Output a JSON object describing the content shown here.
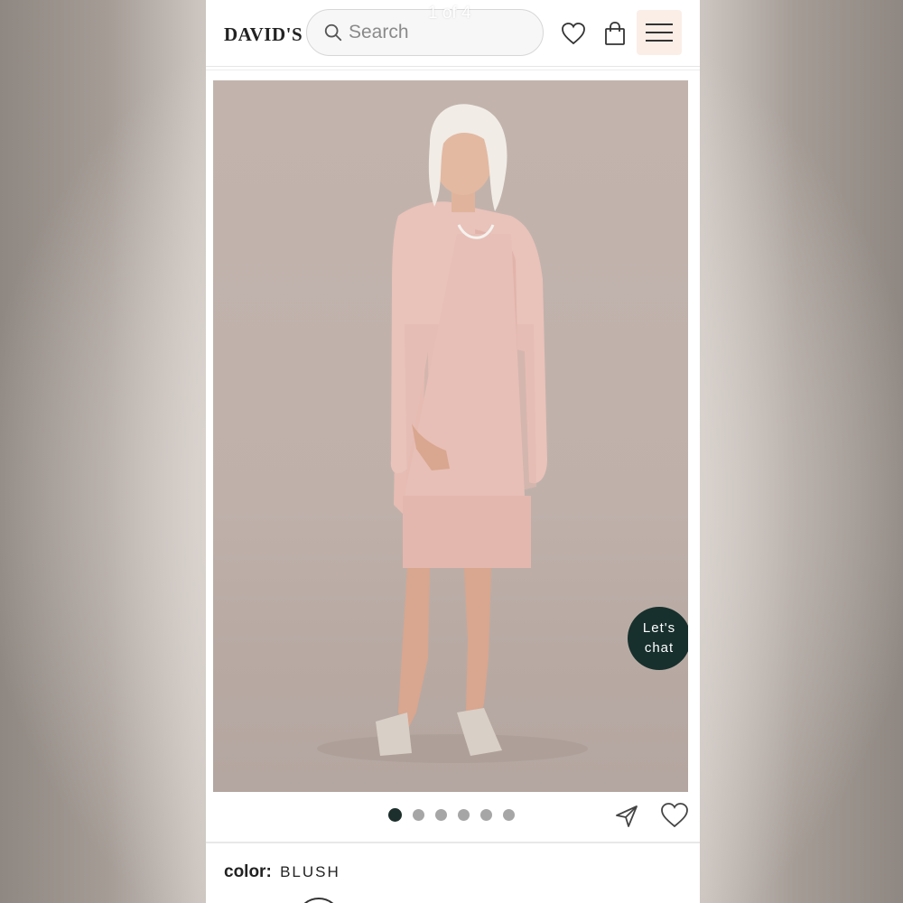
{
  "header": {
    "logo": "DAVID'S",
    "search_placeholder": "Search",
    "image_counter": "1 of 4"
  },
  "product": {
    "chat_label_line1": "Let's",
    "chat_label_line2": "chat",
    "carousel": {
      "total": 6,
      "active_index": 0
    },
    "color_label": "color:",
    "color_value": "BLUSH"
  },
  "colors": {
    "accent": "#17302d",
    "menu_bg": "#fbeee7",
    "garment": "#e8c0b8"
  },
  "icons": [
    "search-icon",
    "heart-icon",
    "shopping-bag-icon",
    "hamburger-menu-icon",
    "share-icon",
    "heart-outline-icon"
  ]
}
